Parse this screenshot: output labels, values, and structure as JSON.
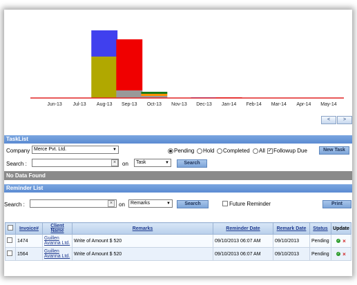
{
  "colors": {
    "section_bar": "#6a98da",
    "no_data_bar": "#8a8a8a",
    "link": "#1f3a8f",
    "chart_baseline": "#e02020"
  },
  "chart_data": {
    "type": "bar",
    "stacked": true,
    "categories": [
      "Jun-13",
      "Jul-13",
      "Aug-13",
      "Sep-13",
      "Oct-13",
      "Nov-13",
      "Dec-13",
      "Jan-14",
      "Feb-14",
      "Mar-14",
      "Apr-14",
      "May-14"
    ],
    "series": [
      {
        "color": "#b1a800",
        "values": [
          0,
          0,
          60,
          0,
          0,
          0,
          0,
          0,
          0,
          0,
          0,
          0
        ]
      },
      {
        "color": "#4040ee",
        "values": [
          0,
          0,
          38,
          0,
          0,
          0,
          1,
          0,
          0,
          0,
          0,
          0
        ]
      },
      {
        "color": "#999999",
        "values": [
          0,
          0,
          0,
          11,
          3,
          0,
          0,
          0,
          0,
          0,
          0,
          0
        ]
      },
      {
        "color": "#f00000",
        "values": [
          0,
          0,
          0,
          74,
          0,
          0,
          0,
          1,
          0,
          0,
          0,
          0
        ]
      },
      {
        "color": "#ff9000",
        "values": [
          0,
          0,
          0,
          0,
          3,
          0,
          0,
          0,
          0,
          0,
          0,
          0
        ]
      },
      {
        "color": "#1a7a1a",
        "values": [
          0,
          0,
          0,
          0,
          3,
          0,
          0,
          0,
          0,
          0,
          0,
          0
        ]
      }
    ],
    "ylim": [
      0,
      100
    ],
    "grid": false,
    "legend": "none",
    "xlabel": "",
    "ylabel": "",
    "title": ""
  },
  "pager": {
    "prev": "<",
    "next": ">"
  },
  "tasklist": {
    "title": "TaskList",
    "company_label": "Company :",
    "company_value": "Merce Pvt. Ltd.",
    "radios": [
      {
        "label": "Pending",
        "checked": true
      },
      {
        "label": "Hold",
        "checked": false
      },
      {
        "label": "Completed",
        "checked": false
      },
      {
        "label": "All",
        "checked": false
      }
    ],
    "followup_label": "Followup Due",
    "new_task_label": "New Task",
    "search_label": "Search :",
    "search_value": "",
    "on_label": "on",
    "on_select_value": "Task",
    "search_button": "Search",
    "no_data": "No Data Found"
  },
  "reminder": {
    "title": "Reminder List",
    "search_label": "Search :",
    "search_value": "",
    "on_label": "on",
    "on_select_value": "Remarks",
    "search_button": "Search",
    "future_label": "Future Reminder",
    "print_button": "Print",
    "columns": [
      "Invoice#",
      "Client Name",
      "Remarks",
      "Reminder Date",
      "Remark Date",
      "Status",
      "Update"
    ],
    "rows": [
      {
        "invoice": "1474",
        "client": "Guillen Avanna Ltd.",
        "remarks": "Write of Amount $ 520",
        "reminder_date": "09/10/2013 06:07 AM",
        "remark_date": "09/10/2013",
        "status": "Pending"
      },
      {
        "invoice": "1564",
        "client": "Guillen Avanna Ltd.",
        "remarks": "Write of Amount $ 520",
        "reminder_date": "09/10/2013 06:07 AM",
        "remark_date": "09/10/2013",
        "status": "Pending"
      }
    ]
  }
}
